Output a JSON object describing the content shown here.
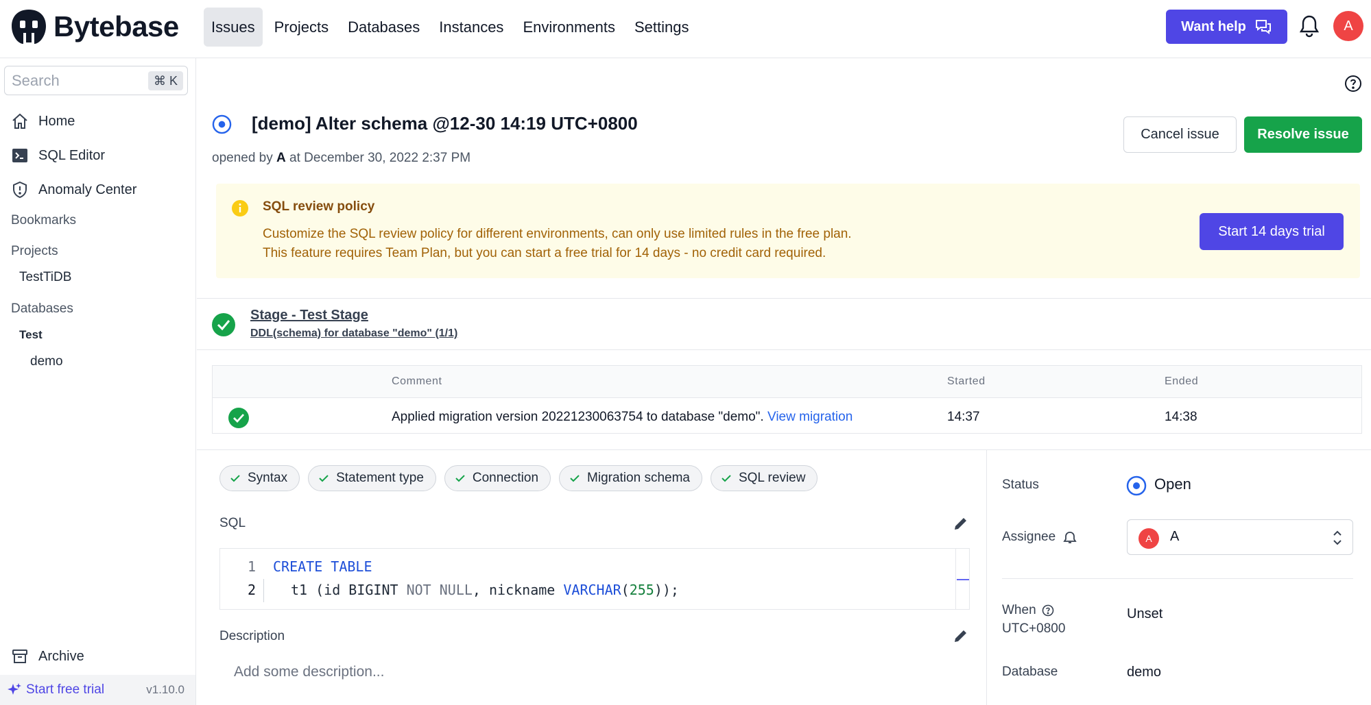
{
  "brand": {
    "name": "Bytebase"
  },
  "nav": {
    "items": [
      "Issues",
      "Projects",
      "Databases",
      "Instances",
      "Environments",
      "Settings"
    ]
  },
  "header": {
    "help_label": "Want help",
    "avatar_initial": "A"
  },
  "sidebar": {
    "search_placeholder": "Search",
    "search_shortcut": "⌘ K",
    "links": {
      "home": "Home",
      "sql_editor": "SQL Editor",
      "anomaly_center": "Anomaly Center"
    },
    "bookmarks": "Bookmarks",
    "projects_heading": "Projects",
    "project": "TestTiDB",
    "databases_heading": "Databases",
    "environment": "Test",
    "database": "demo",
    "archive": "Archive",
    "start_trial": "Start free trial",
    "version": "v1.10.0"
  },
  "issue": {
    "title": "[demo] Alter schema @12-30 14:19 UTC+0800",
    "opened_prefix": "opened by",
    "opened_by": "A",
    "opened_at": "at December 30, 2022 2:37 PM",
    "cancel_label": "Cancel issue",
    "resolve_label": "Resolve issue"
  },
  "policy": {
    "title": "SQL review policy",
    "line1": "Customize the SQL review policy for different environments, can only use limited rules in the free plan.",
    "line2": "This feature requires Team Plan, but you can start a free trial for 14 days - no credit card required.",
    "button": "Start 14 days trial"
  },
  "stage": {
    "title": "Stage - Test Stage",
    "subtitle": "DDL(schema) for database \"demo\" (1/1)"
  },
  "task_table": {
    "headers": {
      "comment": "Comment",
      "started": "Started",
      "ended": "Ended"
    },
    "row": {
      "comment": "Applied migration version 20221230063754 to database \"demo\".",
      "link": "View migration",
      "started": "14:37",
      "ended": "14:38"
    }
  },
  "checks": [
    "Syntax",
    "Statement type",
    "Connection",
    "Migration schema",
    "SQL review"
  ],
  "sql": {
    "label": "SQL",
    "line_numbers": [
      "1",
      "2"
    ]
  },
  "description": {
    "label": "Description",
    "placeholder": "Add some description..."
  },
  "details": {
    "status_label": "Status",
    "status_value": "Open",
    "assignee_label": "Assignee",
    "assignee_initial": "A",
    "assignee_name": "A",
    "when_label": "When",
    "when_tz": "UTC+0800",
    "when_value": "Unset",
    "database_label": "Database",
    "database_value": "demo"
  },
  "colors": {
    "primary": "#4f46e5",
    "success": "#16a34a",
    "danger": "#ef4444",
    "link": "#2563eb",
    "warning_bg": "#fefce8"
  }
}
